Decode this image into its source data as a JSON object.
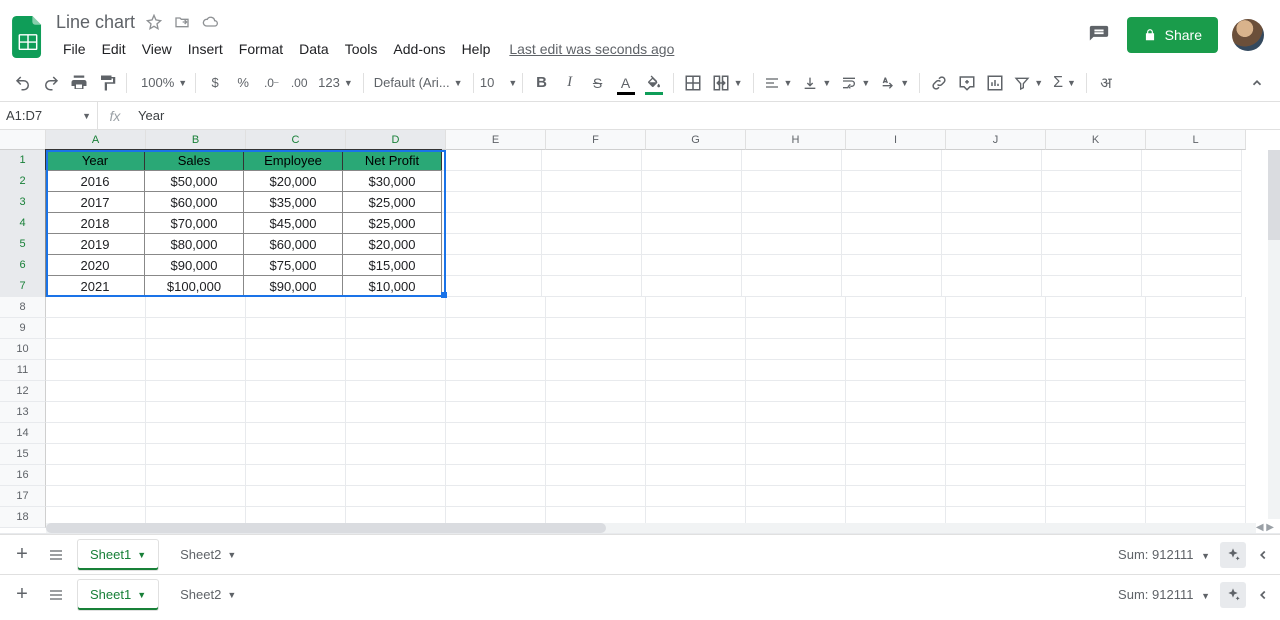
{
  "doc": {
    "title": "Line chart",
    "last_edit": "Last edit was seconds ago"
  },
  "menus": [
    "File",
    "Edit",
    "View",
    "Insert",
    "Format",
    "Data",
    "Tools",
    "Add-ons",
    "Help"
  ],
  "share": {
    "label": "Share"
  },
  "toolbar": {
    "zoom": "100%",
    "font": "Default (Ari...",
    "font_size": "10",
    "more_formats": "123",
    "input_lang": "अ"
  },
  "namebox": "A1:D7",
  "formula_value": "Year",
  "col_letters": [
    "A",
    "B",
    "C",
    "D",
    "E",
    "F",
    "G",
    "H",
    "I",
    "J",
    "K",
    "L"
  ],
  "row_numbers": [
    "1",
    "2",
    "3",
    "4",
    "5",
    "6",
    "7",
    "8",
    "9",
    "10",
    "11",
    "12",
    "13",
    "14",
    "15",
    "16",
    "17",
    "18"
  ],
  "table": {
    "headers": [
      "Year",
      "Sales",
      "Employee Salary",
      "Net Profit"
    ],
    "rows": [
      [
        "2016",
        "$50,000",
        "$20,000",
        "$30,000"
      ],
      [
        "2017",
        "$60,000",
        "$35,000",
        "$25,000"
      ],
      [
        "2018",
        "$70,000",
        "$45,000",
        "$25,000"
      ],
      [
        "2019",
        "$80,000",
        "$60,000",
        "$20,000"
      ],
      [
        "2020",
        "$90,000",
        "$75,000",
        "$15,000"
      ],
      [
        "2021",
        "$100,000",
        "$90,000",
        "$10,000"
      ]
    ]
  },
  "sheets": {
    "tab1": "Sheet1",
    "tab2": "Sheet2"
  },
  "status": {
    "sum": "Sum: 912111"
  },
  "chart_data": {
    "type": "table",
    "title": "Line chart",
    "categories": [
      "2016",
      "2017",
      "2018",
      "2019",
      "2020",
      "2021"
    ],
    "series": [
      {
        "name": "Sales",
        "values": [
          50000,
          60000,
          70000,
          80000,
          90000,
          100000
        ]
      },
      {
        "name": "Employee Salary",
        "values": [
          20000,
          35000,
          45000,
          60000,
          75000,
          90000
        ]
      },
      {
        "name": "Net Profit",
        "values": [
          30000,
          25000,
          25000,
          20000,
          15000,
          10000
        ]
      }
    ],
    "xlabel": "Year",
    "ylabel": "",
    "ylim": [
      0,
      100000
    ]
  }
}
